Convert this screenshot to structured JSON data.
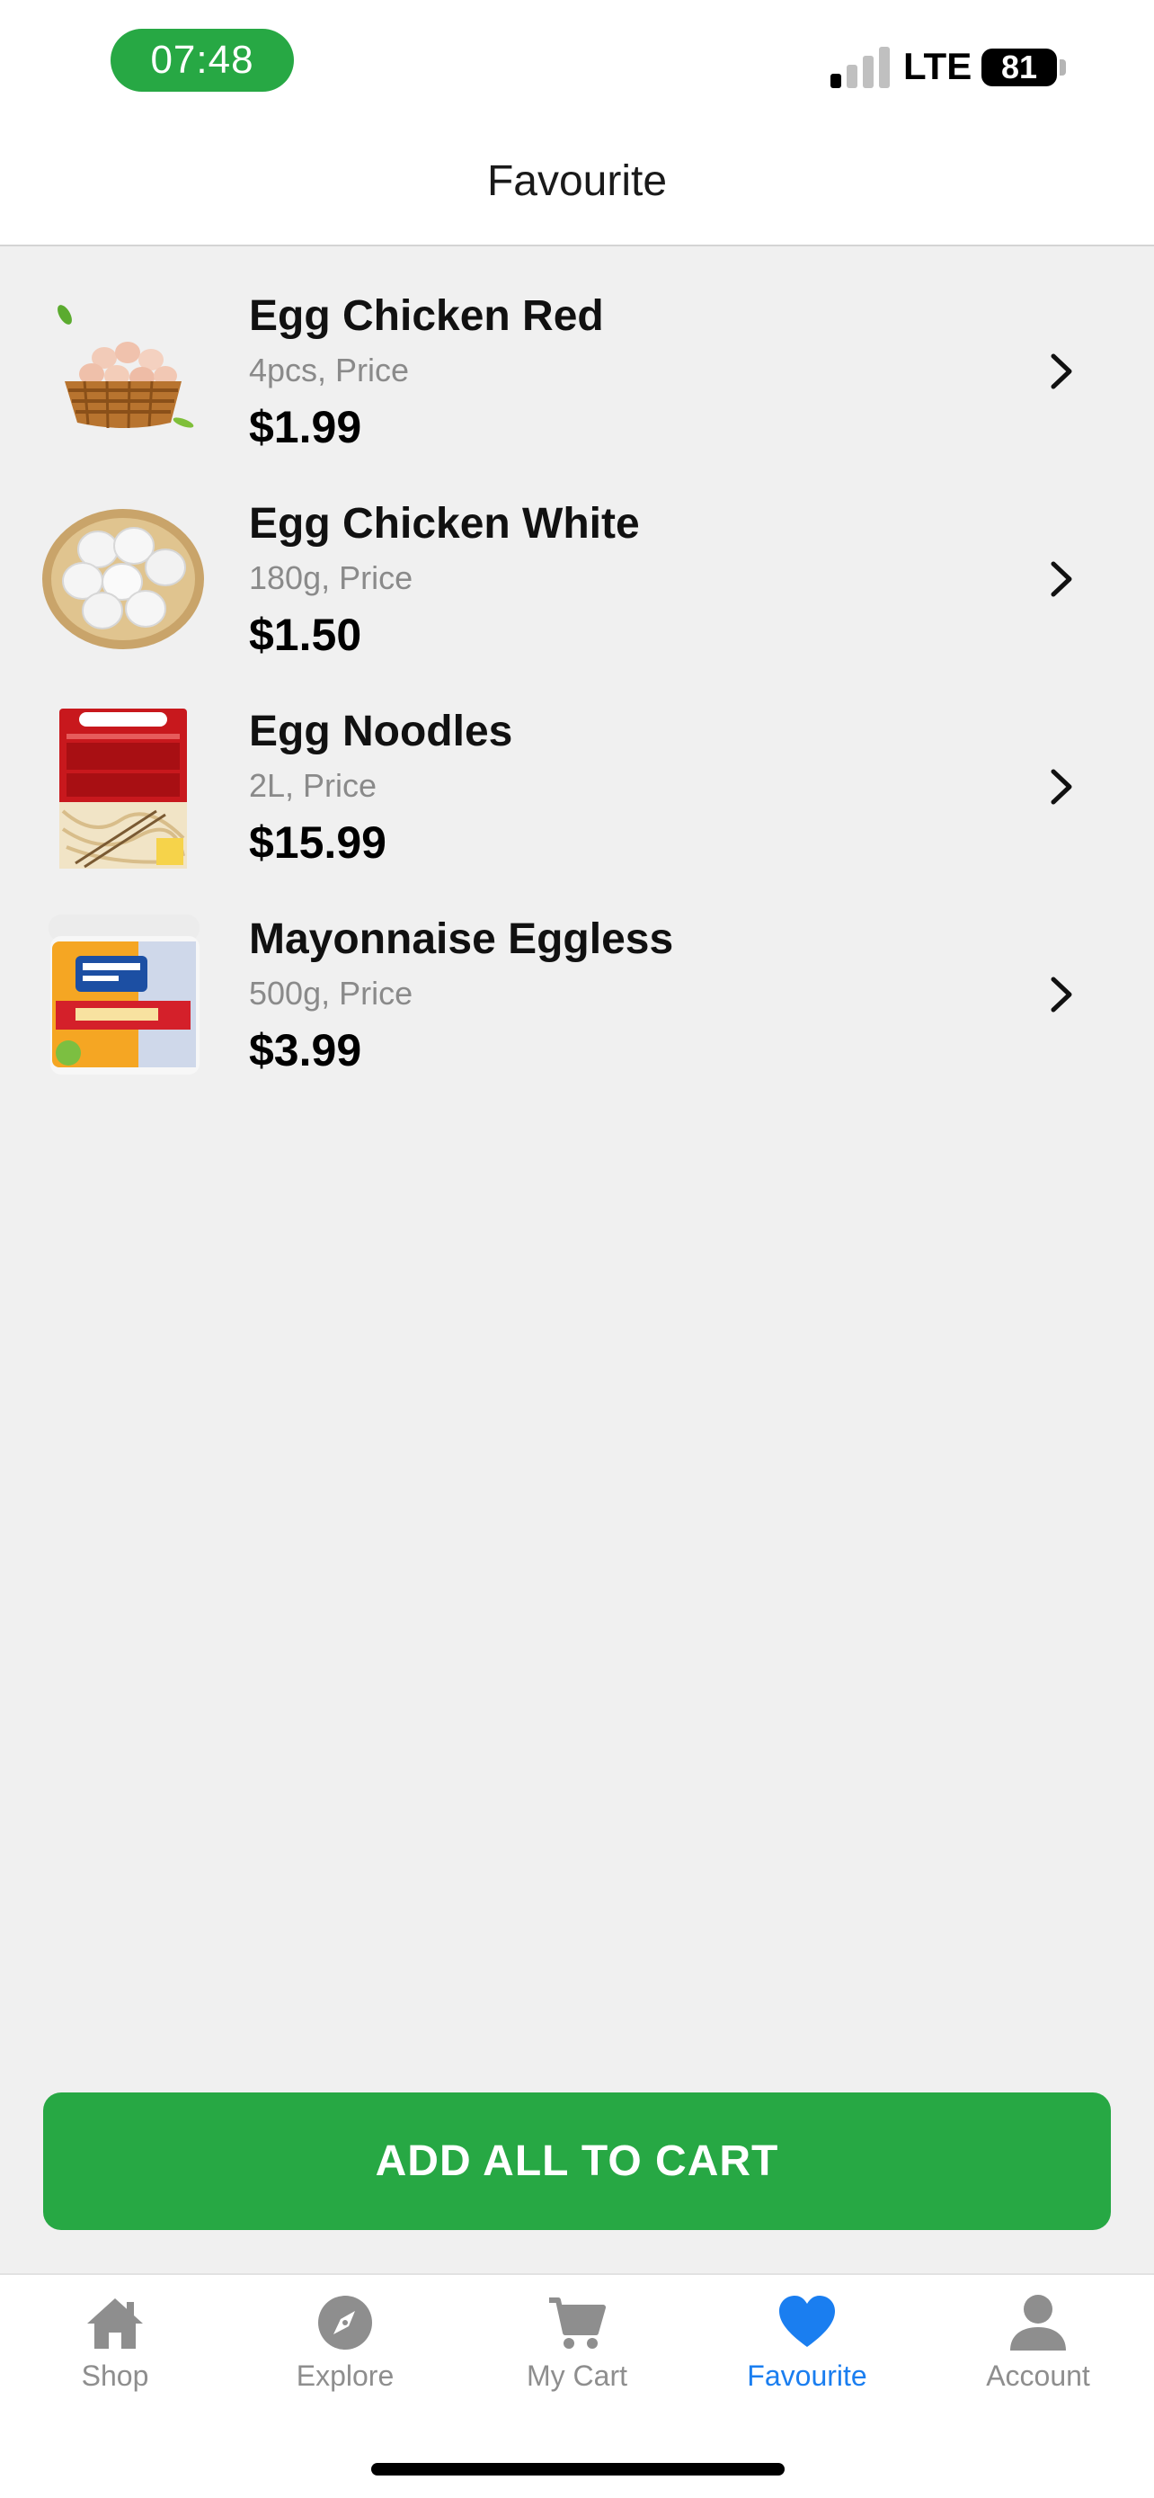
{
  "status_bar": {
    "time": "07:48",
    "network": "LTE",
    "battery": "81"
  },
  "header": {
    "title": "Favourite"
  },
  "items": [
    {
      "name": "Egg Chicken Red",
      "desc": "4pcs, Price",
      "price": "$1.99",
      "image": "eggs-in-basket"
    },
    {
      "name": "Egg Chicken White",
      "desc": "180g, Price",
      "price": "$1.50",
      "image": "white-eggs-bowl"
    },
    {
      "name": "Egg Noodles",
      "desc": "2L, Price",
      "price": "$15.99",
      "image": "egg-noodles-pack"
    },
    {
      "name": "Mayonnaise Eggless",
      "desc": "500g, Price",
      "price": "$3.99",
      "image": "mayonnaise-jar"
    }
  ],
  "add_all_label": "ADD ALL TO CART",
  "tabs": [
    {
      "label": "Shop",
      "icon": "home-icon"
    },
    {
      "label": "Explore",
      "icon": "compass-icon"
    },
    {
      "label": "My Cart",
      "icon": "cart-icon"
    },
    {
      "label": "Favourite",
      "icon": "heart-icon",
      "active": true
    },
    {
      "label": "Account",
      "icon": "user-icon"
    }
  ],
  "colors": {
    "accent_green": "#27a844",
    "active_tab": "#1a7ef0",
    "inactive_tab": "#8e8e8e",
    "background": "#f0f0f0"
  }
}
